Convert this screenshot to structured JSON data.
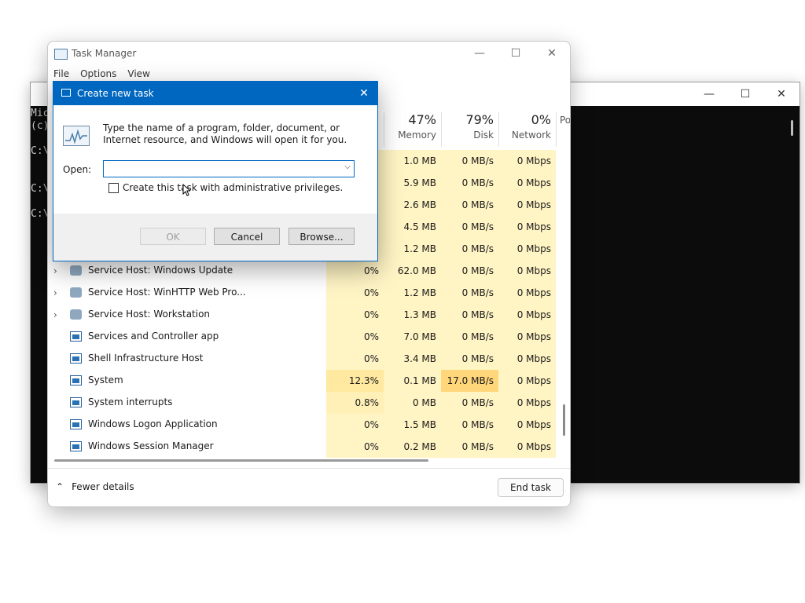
{
  "console": {
    "lines": [
      "Mic",
      "(c)",
      "",
      "C:\\",
      "",
      "",
      "C:\\",
      "",
      "C:\\"
    ]
  },
  "task_manager": {
    "title": "Task Manager",
    "menu": [
      "File",
      "Options",
      "View"
    ],
    "columns": [
      {
        "pct": "47%",
        "label": "Memory"
      },
      {
        "pct": "79%",
        "label": "Disk"
      },
      {
        "pct": "0%",
        "label": "Network"
      },
      {
        "pct": "",
        "label": "Po"
      }
    ],
    "rows": [
      {
        "name": "",
        "cpu": "",
        "mem": "1.0 MB",
        "disk": "0 MB/s",
        "net": "0 Mbps"
      },
      {
        "name": "",
        "cpu": "",
        "mem": "5.9 MB",
        "disk": "0 MB/s",
        "net": "0 Mbps"
      },
      {
        "name": "",
        "cpu": "",
        "mem": "2.6 MB",
        "disk": "0 MB/s",
        "net": "0 Mbps"
      },
      {
        "name": "",
        "cpu": "",
        "mem": "4.5 MB",
        "disk": "0 MB/s",
        "net": "0 Mbps"
      },
      {
        "name": "",
        "cpu": "",
        "mem": "1.2 MB",
        "disk": "0 MB/s",
        "net": "0 Mbps"
      },
      {
        "name": "Service Host: Windows Update",
        "cpu": "0%",
        "mem": "62.0 MB",
        "disk": "0 MB/s",
        "net": "0 Mbps"
      },
      {
        "name": "Service Host: WinHTTP Web Pro...",
        "cpu": "0%",
        "mem": "1.2 MB",
        "disk": "0 MB/s",
        "net": "0 Mbps"
      },
      {
        "name": "Service Host: Workstation",
        "cpu": "0%",
        "mem": "1.3 MB",
        "disk": "0 MB/s",
        "net": "0 Mbps"
      },
      {
        "name": "Services and Controller app",
        "cpu": "0%",
        "mem": "7.0 MB",
        "disk": "0 MB/s",
        "net": "0 Mbps"
      },
      {
        "name": "Shell Infrastructure Host",
        "cpu": "0%",
        "mem": "3.4 MB",
        "disk": "0 MB/s",
        "net": "0 Mbps"
      },
      {
        "name": "System",
        "cpu": "12.3%",
        "mem": "0.1 MB",
        "disk": "17.0 MB/s",
        "net": "0 Mbps"
      },
      {
        "name": "System interrupts",
        "cpu": "0.8%",
        "mem": "0 MB",
        "disk": "0 MB/s",
        "net": "0 Mbps"
      },
      {
        "name": "Windows Logon Application",
        "cpu": "0%",
        "mem": "1.5 MB",
        "disk": "0 MB/s",
        "net": "0 Mbps"
      },
      {
        "name": "Windows Session Manager",
        "cpu": "0%",
        "mem": "0.2 MB",
        "disk": "0 MB/s",
        "net": "0 Mbps"
      }
    ],
    "footer": {
      "fewer_details": "Fewer details",
      "end_task": "End task"
    }
  },
  "dialog": {
    "title": "Create new task",
    "message": "Type the name of a program, folder, document, or Internet resource, and Windows will open it for you.",
    "open_label": "Open:",
    "open_value": "",
    "admin_label": "Create this task with administrative privileges.",
    "ok": "OK",
    "cancel": "Cancel",
    "browse": "Browse..."
  },
  "icons": {
    "minimize": "minimize-icon",
    "maximize": "maximize-icon",
    "close": "close-icon",
    "expand": "chevron-right-icon",
    "collapse": "chevron-up-icon"
  },
  "colors": {
    "accent": "#0067c0",
    "heat_low": "#fff4c4",
    "heat_mid": "#ffe8a0",
    "heat_high": "#ffd67a"
  }
}
